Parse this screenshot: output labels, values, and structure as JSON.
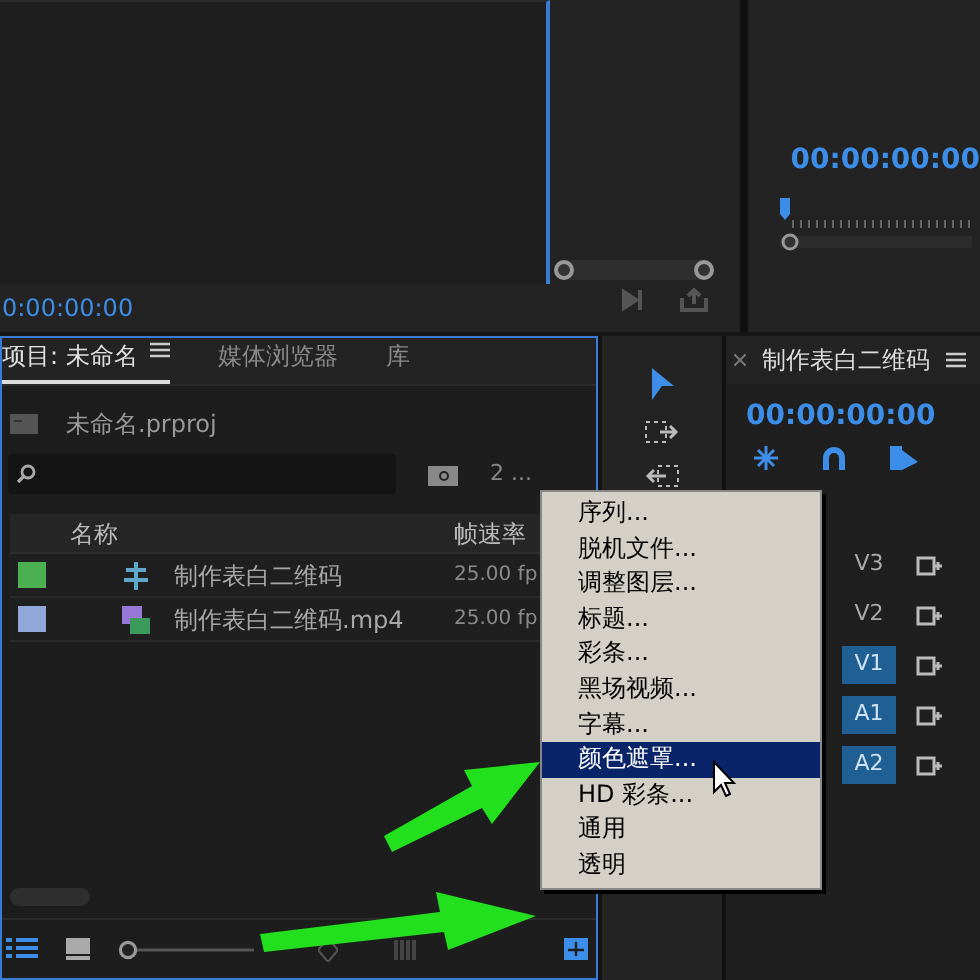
{
  "source_monitor": {
    "timecode": "0:00:00:00"
  },
  "zoom_slider": {
    "level": 0
  },
  "program_monitor": {
    "timecode": "00:00:00:00"
  },
  "project_panel": {
    "tabs": [
      {
        "label": "项目: 未命名",
        "selected": true
      },
      {
        "label": "媒体浏览器",
        "selected": false
      },
      {
        "label": "库",
        "selected": false
      }
    ],
    "project_file": "未命名.prproj",
    "item_count": "2 ...",
    "columns": [
      "名称",
      "帧速率"
    ],
    "rows": [
      {
        "color": "#4caf50",
        "kind": "sequence",
        "name": "制作表白二维码",
        "frame_rate": "25.00 fp"
      },
      {
        "color": "#8fa8d8",
        "kind": "clip",
        "name": "制作表白二维码.mp4",
        "frame_rate": "25.00 fp"
      }
    ]
  },
  "timeline": {
    "title": "制作表白二维码",
    "timecode": "00:00:00:00",
    "tracks": [
      {
        "label": "V3",
        "selected": false
      },
      {
        "label": "V2",
        "selected": false
      },
      {
        "label": "V1",
        "selected": true
      },
      {
        "label": "A1",
        "selected": true
      },
      {
        "label": "A2",
        "selected": true
      }
    ]
  },
  "context_menu": {
    "items": [
      {
        "label": "序列...",
        "selected": false
      },
      {
        "label": "脱机文件...",
        "selected": false
      },
      {
        "label": "调整图层...",
        "selected": false
      },
      {
        "label": "标题...",
        "selected": false
      },
      {
        "label": "彩条...",
        "selected": false
      },
      {
        "label": "黑场视频...",
        "selected": false
      },
      {
        "label": "字幕...",
        "selected": false
      },
      {
        "label": "颜色遮罩...",
        "selected": true
      },
      {
        "label": "HD 彩条...",
        "selected": false
      },
      {
        "label": "通用",
        "selected": false
      },
      {
        "label": "透明",
        "selected": false
      }
    ]
  }
}
